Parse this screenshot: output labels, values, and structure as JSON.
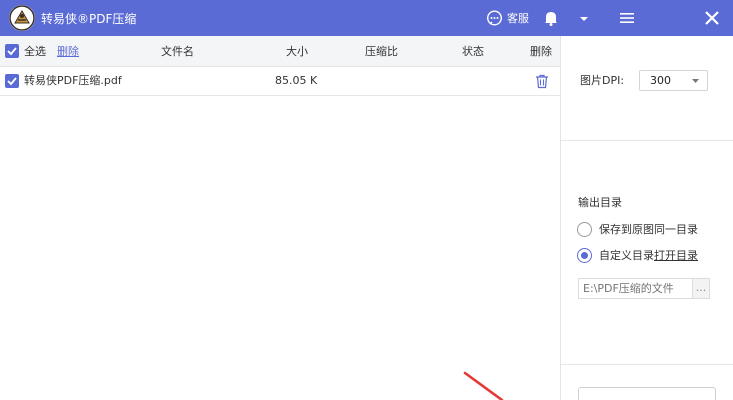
{
  "app": {
    "title": "转易侠®PDF压缩",
    "service_label": "客服",
    "accent": "#5b6bd6"
  },
  "table": {
    "select_all_label": "全选",
    "delete_link": "删除",
    "columns": [
      "文件名",
      "大小",
      "压缩比",
      "状态",
      "删除"
    ],
    "rows": [
      {
        "name": "转易侠PDF压缩.pdf",
        "size": "85.05 K",
        "ratio": "",
        "status": ""
      }
    ]
  },
  "settings": {
    "dpi_label": "图片DPI:",
    "dpi_value": "300",
    "output_title": "输出目录",
    "option_same": "保存到原图同一目录",
    "option_custom": "自定义目录",
    "open_dir_link": "打开目录",
    "path_placeholder": "E:\\PDF压缩的文件",
    "browse_label": "..."
  },
  "icons": [
    "logo-icon",
    "chat-icon",
    "bell-icon",
    "chevron-down-icon",
    "hamburger-menu-icon",
    "close-icon",
    "checkbox-icon",
    "trash-icon",
    "arrow-icon"
  ]
}
